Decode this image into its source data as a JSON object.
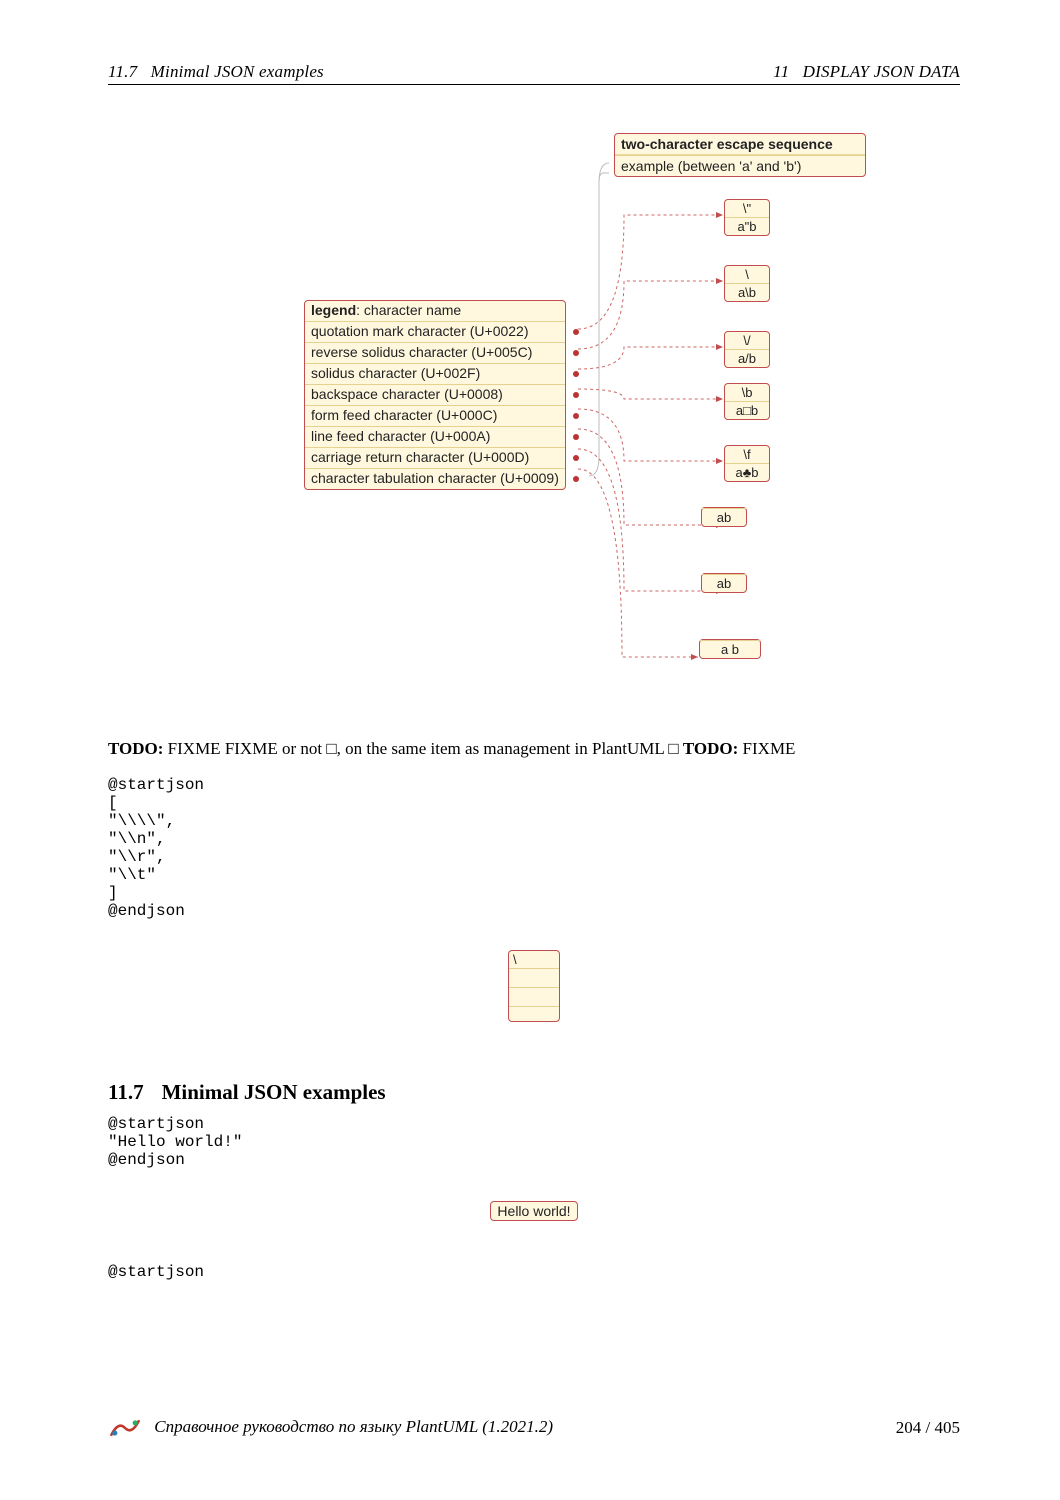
{
  "header": {
    "left_num": "11.7",
    "left_title": "Minimal JSON examples",
    "right_num": "11",
    "right_title": "DISPLAY JSON DATA"
  },
  "diagram": {
    "group_title": "two-character escape sequence",
    "group_sub": "example (between 'a' and 'b')",
    "legend_title_prefix": "legend",
    "legend_title_suffix": ": character name",
    "legend_rows": [
      "quotation mark character (U+0022)",
      "reverse solidus character (U+005C)",
      "solidus character (U+002F)",
      "backspace character (U+0008)",
      "form feed character (U+000C)",
      "line feed character (U+000A)",
      "carriage return character (U+000D)",
      "character tabulation character (U+0009)"
    ],
    "examples": [
      {
        "esc": "\\\"",
        "val": "a\"b"
      },
      {
        "esc": "\\",
        "val": "a\\b"
      },
      {
        "esc": "\\/",
        "val": "a/b"
      },
      {
        "esc": "\\b",
        "val": "a□b"
      },
      {
        "esc": "\\f",
        "val": "a♣b"
      },
      {
        "esc": "",
        "val": "ab"
      },
      {
        "esc": "",
        "val": "ab"
      },
      {
        "esc": "",
        "val": "a   b"
      }
    ]
  },
  "todo": {
    "prefix": "TODO:",
    "text1": " FIXME FIXME or not □, on the same item as  management in PlantUML □ ",
    "prefix2": "TODO:",
    "text2": " FIXME"
  },
  "code1": "@startjson\n[\n\"\\\\\\\\\",\n\"\\\\n\",\n\"\\\\r\",\n\"\\\\t\"\n]\n@endjson",
  "small_diagram_top": "\\",
  "section": {
    "num": "11.7",
    "title": "Minimal JSON examples"
  },
  "code2": "@startjson\n\"Hello world!\"\n@endjson",
  "hello_label": "Hello world!",
  "code3": "@startjson",
  "footer": {
    "title": "Справочное руководство по языку PlantUML (1.2021.2)",
    "page": "204 / 405"
  }
}
